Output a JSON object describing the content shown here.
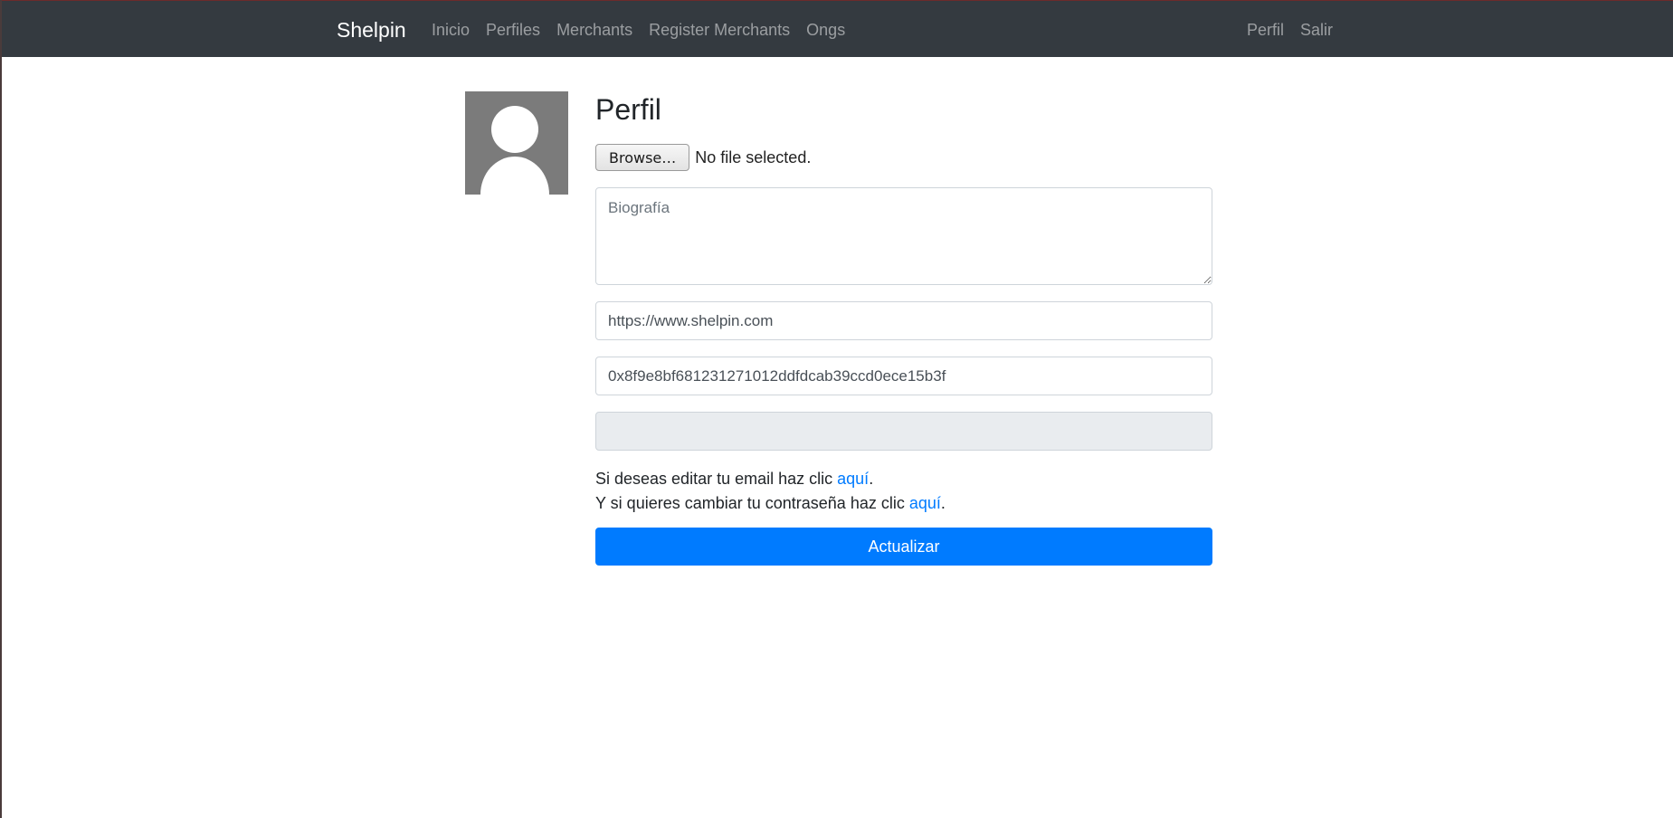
{
  "navbar": {
    "brand": "Shelpin",
    "links": [
      "Inicio",
      "Perfiles",
      "Merchants",
      "Register Merchants",
      "Ongs"
    ],
    "right_links": [
      "Perfil",
      "Salir"
    ]
  },
  "profile": {
    "title": "Perfil",
    "browse_label": "Browse…",
    "file_status": "No file selected.",
    "bio_placeholder": "Biografía",
    "website_value": "https://www.shelpin.com",
    "wallet_value": "0x8f9e8bf681231271012ddfdcab39ccd0ece15b3f",
    "disabled_value": "",
    "email_text_pre": "Si deseas editar tu email haz clic ",
    "email_link": "aquí",
    "email_text_post": ".",
    "password_text_pre": "Y si quieres cambiar tu contraseña haz clic ",
    "password_link": "aquí",
    "password_text_post": ".",
    "submit_label": "Actualizar"
  },
  "colors": {
    "navbar_bg": "#343a40",
    "primary": "#007bff",
    "avatar_bg": "#7b7b7b"
  }
}
